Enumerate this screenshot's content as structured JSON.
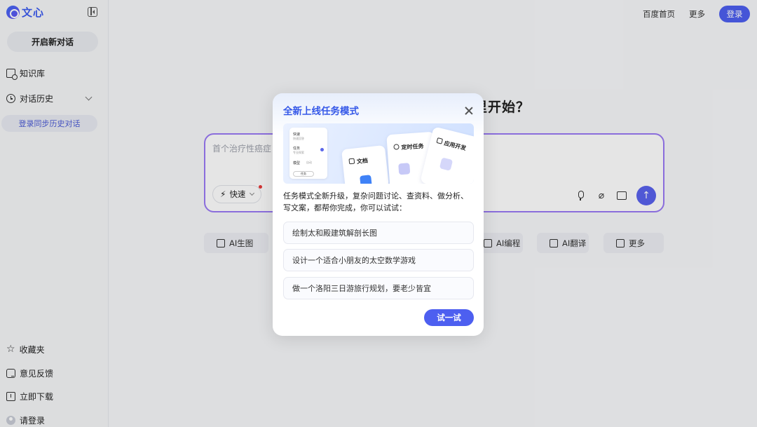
{
  "app": {
    "logo_text": "文心"
  },
  "sidebar": {
    "new_chat_label": "开启新对话",
    "items": [
      {
        "label": "知识库",
        "icon": "folder-search-icon"
      },
      {
        "label": "对话历史",
        "icon": "clock-icon"
      }
    ],
    "login_sync_label": "登录同步历史对话",
    "bottom_items": [
      {
        "label": "收藏夹",
        "icon": "star-icon"
      },
      {
        "label": "意见反馈",
        "icon": "feedback-icon"
      },
      {
        "label": "立即下载",
        "icon": "download-icon"
      },
      {
        "label": "请登录",
        "icon": "user-avatar-icon"
      }
    ]
  },
  "header": {
    "links": [
      "百度首页",
      "更多"
    ],
    "login_label": "登录"
  },
  "main": {
    "hero_title_visible": "里开始？",
    "composer": {
      "placeholder": "首个治疗性癌症",
      "mode_label": "快速"
    },
    "chips": [
      {
        "label": "AI生图",
        "icon": "image-gen-icon"
      },
      {
        "label": "AI编程",
        "icon": "code-icon"
      },
      {
        "label": "AI翻译",
        "icon": "translate-icon"
      },
      {
        "label": "更多",
        "icon": "more-apps-icon"
      }
    ]
  },
  "modal": {
    "title": "全新上线任务模式",
    "banner": {
      "panel_rows": [
        {
          "title": "快速",
          "sub": "快速回答"
        },
        {
          "title": "任务",
          "sub": "专业探索"
        },
        {
          "title": "模型",
          "sub": "自动"
        }
      ],
      "panel_chip": "任务",
      "cards": [
        "文档",
        "定时任务",
        "应用开发"
      ]
    },
    "description": "任务模式全新升级，复杂问题讨论、查资料、做分析、写文案，都帮你完成，你可以试试：",
    "suggestions": [
      "绘制太和殿建筑解剖长图",
      "设计一个适合小朋友的太空数学游戏",
      "做一个洛阳三日游旅行规划，要老少皆宜"
    ],
    "try_label": "试一试"
  },
  "colors": {
    "accent": "#4d5ff0",
    "title_blue": "#3558e8",
    "composer_border": "#9a7af5"
  }
}
